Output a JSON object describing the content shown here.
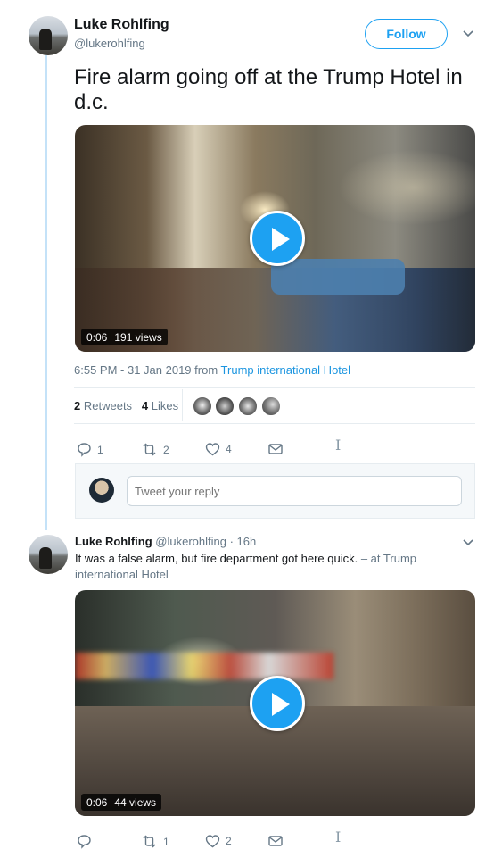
{
  "tweet": {
    "author_name": "Luke Rohlfing",
    "author_handle": "@lukerohlfing",
    "follow_label": "Follow",
    "text": "Fire alarm going off at the Trump Hotel in d.c.",
    "video": {
      "duration": "0:06",
      "views": "191 views"
    },
    "timestamp": "6:55 PM - 31 Jan 2019",
    "from_word": "from",
    "location": "Trump international Hotel",
    "retweets_count": "2",
    "retweets_label": "Retweets",
    "likes_count": "4",
    "likes_label": "Likes",
    "actions": {
      "replies": "1",
      "retweets": "2",
      "likes": "4"
    }
  },
  "reply_box": {
    "placeholder": "Tweet your reply"
  },
  "reply": {
    "author_name": "Luke Rohlfing",
    "author_handle": "@lukerohlfing",
    "time": "· 16h",
    "text": "It was a false alarm, but fire department got here quick.",
    "location_prefix": "– at",
    "location": "Trump international Hotel",
    "video": {
      "duration": "0:06",
      "views": "44 views"
    },
    "actions": {
      "replies": "",
      "retweets": "1",
      "likes": "2"
    }
  },
  "colors": {
    "accent": "#1da1f2",
    "link": "#1b95e0",
    "muted": "#657786",
    "thread": "#c4e2f8"
  }
}
